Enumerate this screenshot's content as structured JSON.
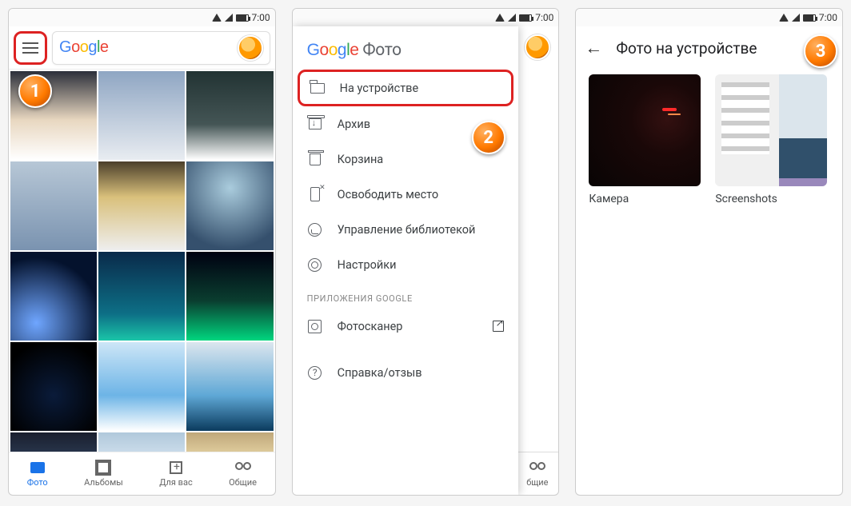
{
  "status": {
    "time": "7:00"
  },
  "phone1": {
    "searchPlaceholder": "Google",
    "nav": {
      "photos": "Фото",
      "albums": "Альбомы",
      "foryou": "Для вас",
      "shared": "Общие"
    }
  },
  "phone2": {
    "drawerTitle": "Фото",
    "items": {
      "device": "На устройстве",
      "archive": "Архив",
      "trash": "Корзина",
      "freeup": "Освободить место",
      "managelib": "Управление библиотекой",
      "settings": "Настройки"
    },
    "sectionGoogleApps": "ПРИЛОЖЕНИЯ GOOGLE",
    "photoscanner": "Фотосканер",
    "helpfeedback": "Справка/отзыв",
    "behindNav": "бщие"
  },
  "phone3": {
    "title": "Фото на устройстве",
    "albums": {
      "camera": "Камера",
      "screenshots": "Screenshots"
    }
  },
  "callouts": {
    "one": "1",
    "two": "2",
    "three": "3"
  }
}
